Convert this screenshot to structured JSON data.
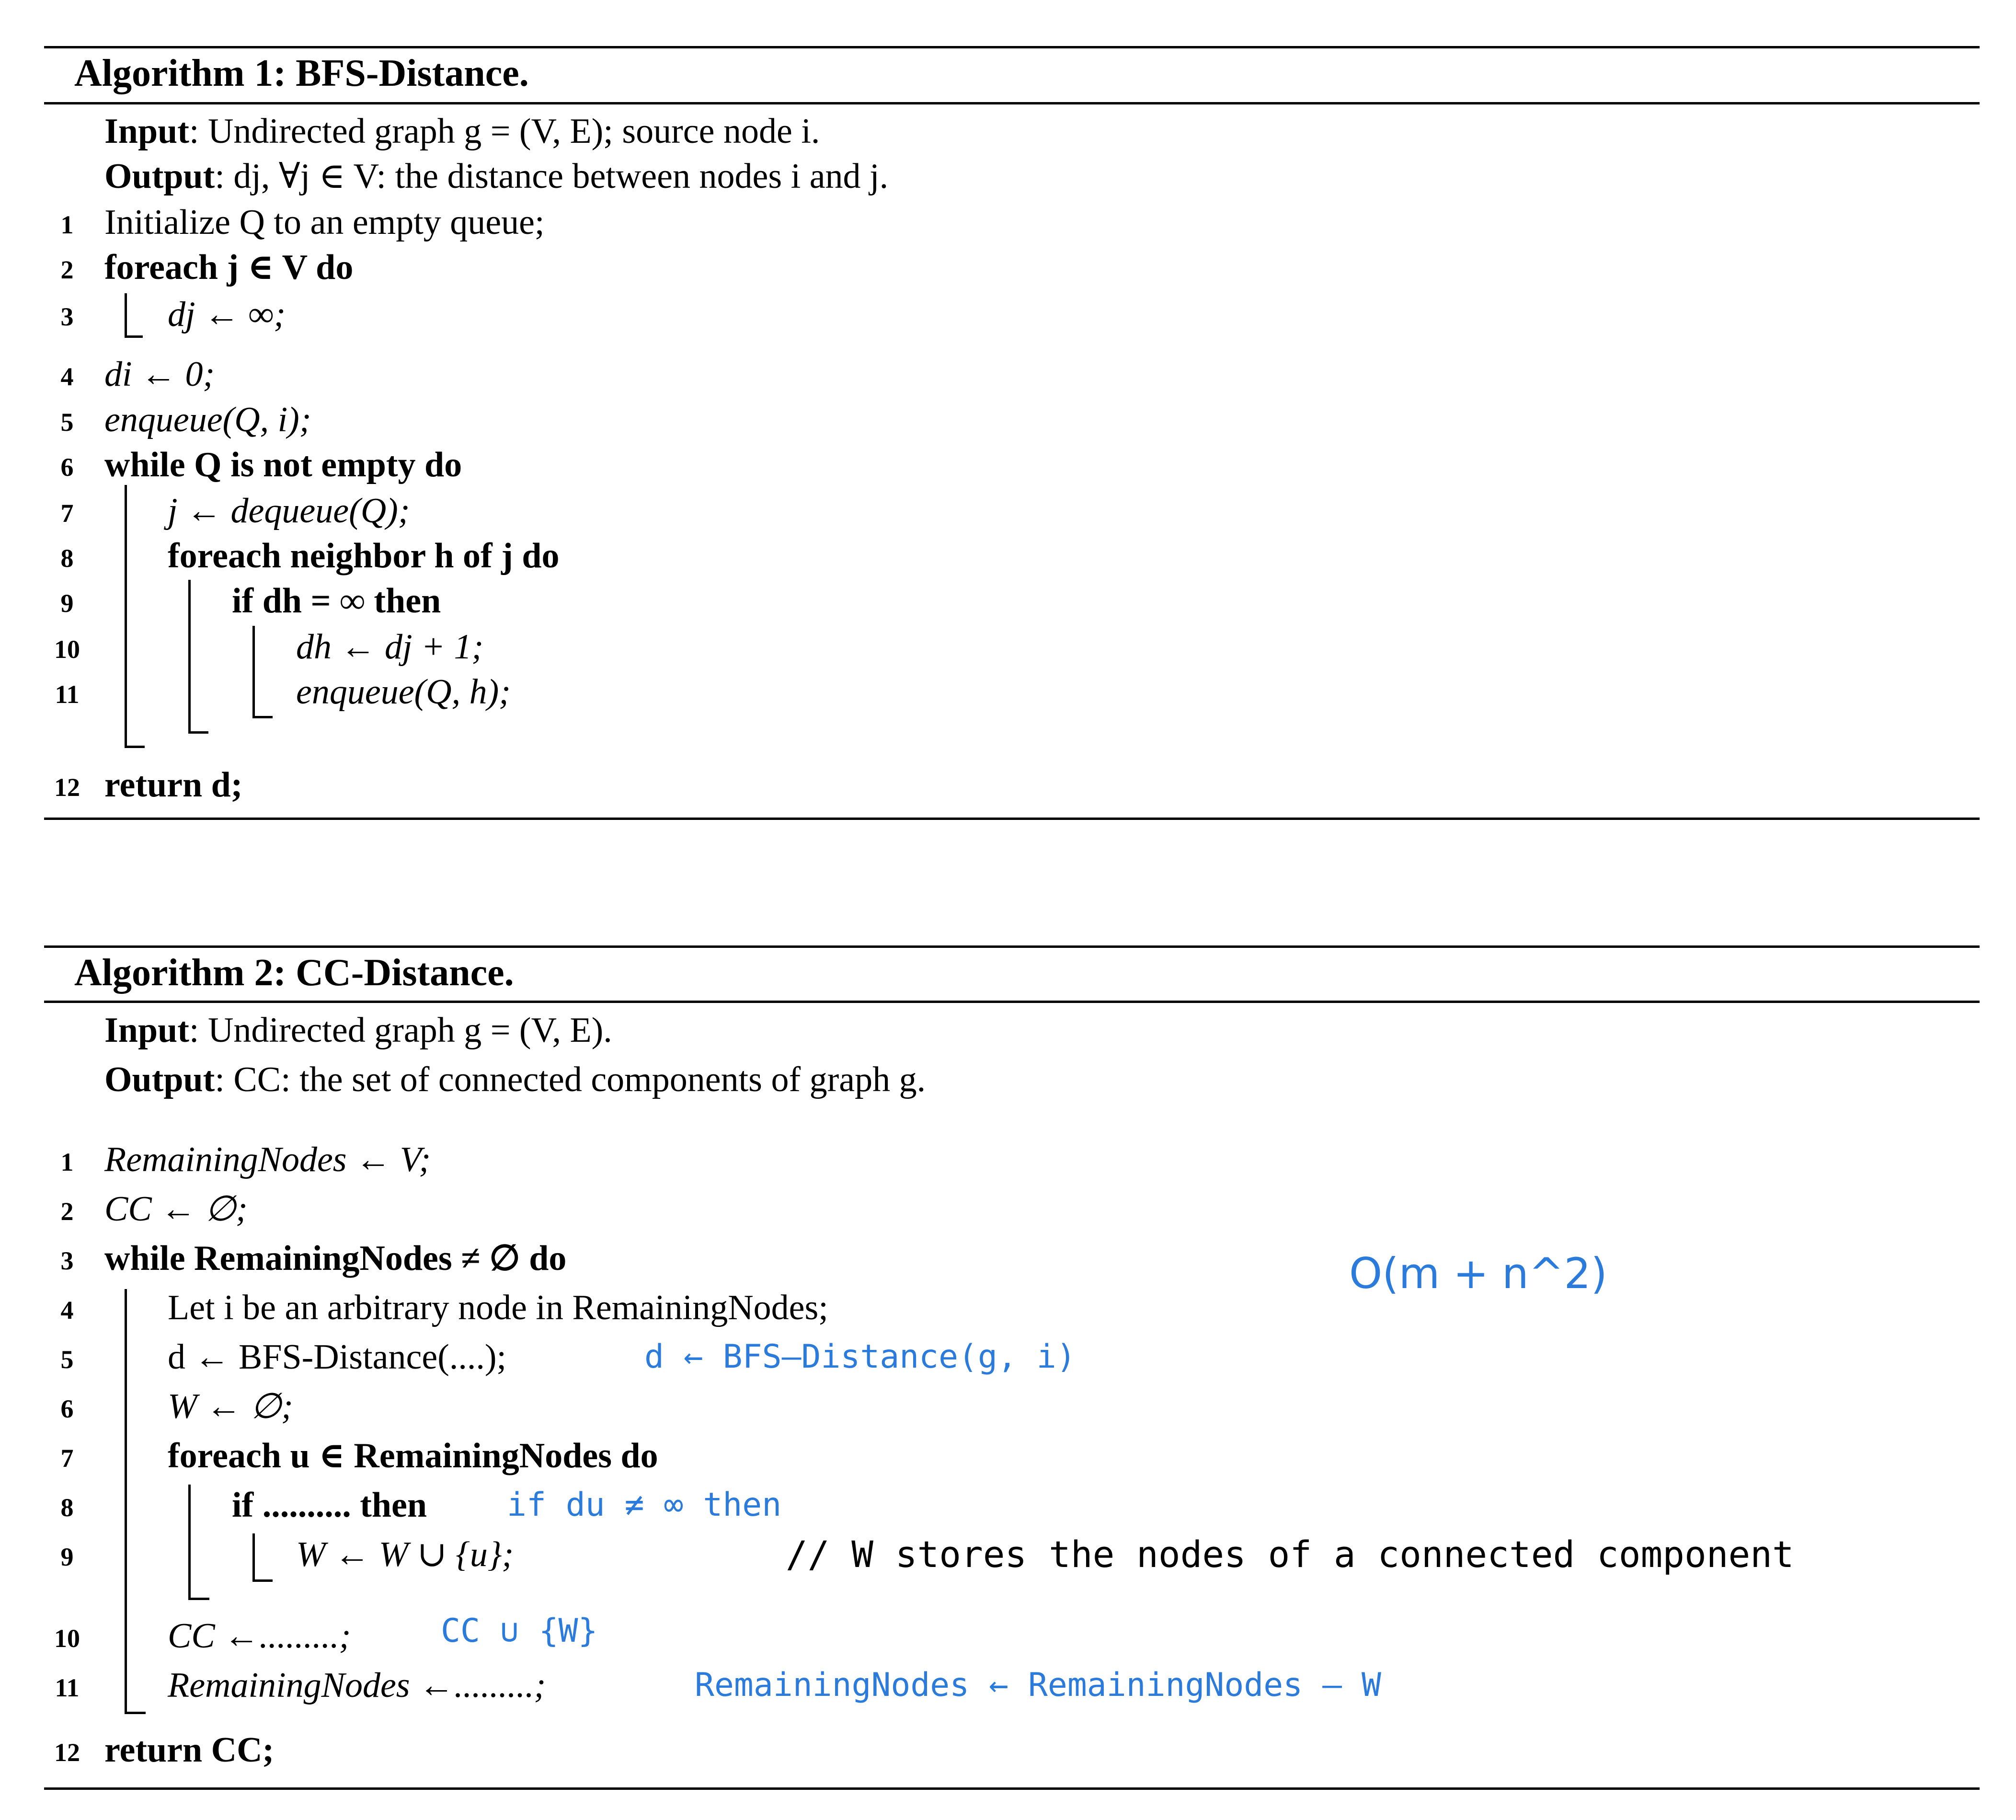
{
  "algorithm1": {
    "title": "Algorithm 1: BFS-Distance.",
    "input": {
      "label": "Input",
      "text": ": Undirected graph g = (V, E); source node i."
    },
    "output": {
      "label": "Output",
      "text": ": dj, ∀j ∈ V: the distance between nodes i and j."
    },
    "lines": [
      {
        "n": "1",
        "text": "Initialize Q to an empty queue;"
      },
      {
        "n": "2",
        "text": "foreach j ∈ V do"
      },
      {
        "n": "3",
        "text": "dj ← ∞;"
      },
      {
        "n": "4",
        "text": "di ← 0;"
      },
      {
        "n": "5",
        "text": "enqueue(Q, i);"
      },
      {
        "n": "6",
        "text": "while Q is not empty do"
      },
      {
        "n": "7",
        "text": "j ← dequeue(Q);"
      },
      {
        "n": "8",
        "text": "foreach neighbor h of j do"
      },
      {
        "n": "9",
        "text": "if dh = ∞ then"
      },
      {
        "n": "10",
        "text": "dh ← dj + 1;"
      },
      {
        "n": "11",
        "text": "enqueue(Q, h);"
      },
      {
        "n": "12",
        "text": "return d;"
      }
    ]
  },
  "algorithm2": {
    "title": "Algorithm 2: CC-Distance.",
    "input": {
      "label": "Input",
      "text": ": Undirected graph g = (V, E)."
    },
    "output": {
      "label": "Output",
      "text": ": CC: the set of connected components of graph g."
    },
    "lines": [
      {
        "n": "1",
        "text": "RemainingNodes ← V;"
      },
      {
        "n": "2",
        "text": "CC ← ∅;"
      },
      {
        "n": "3",
        "text": "while RemainingNodes ≠ ∅ do"
      },
      {
        "n": "4",
        "text": "Let i be an arbitrary node in RemainingNodes;"
      },
      {
        "n": "5",
        "text": "d ← BFS-Distance(....);"
      },
      {
        "n": "6",
        "text": "W ← ∅;"
      },
      {
        "n": "7",
        "text": "foreach u ∈ RemainingNodes do"
      },
      {
        "n": "8",
        "text": "if .......... then"
      },
      {
        "n": "9",
        "text": "W ← W ∪ {u};"
      },
      {
        "n": "10",
        "text": "CC ←.........;"
      },
      {
        "n": "11",
        "text": "RemainingNodes ←.........;"
      },
      {
        "n": "12",
        "text": "return CC;"
      }
    ],
    "comment": "// W stores the nodes of a connected component"
  },
  "annotations": {
    "complexity": "O(m + n^2)",
    "line5": "d ← BFS–Distance(g, i)",
    "line8": "if du ≠ ∞ then",
    "line10": "CC ∪ {W}",
    "line11": "RemainingNodes ← RemainingNodes – W",
    "color": "#2b7bdc"
  }
}
